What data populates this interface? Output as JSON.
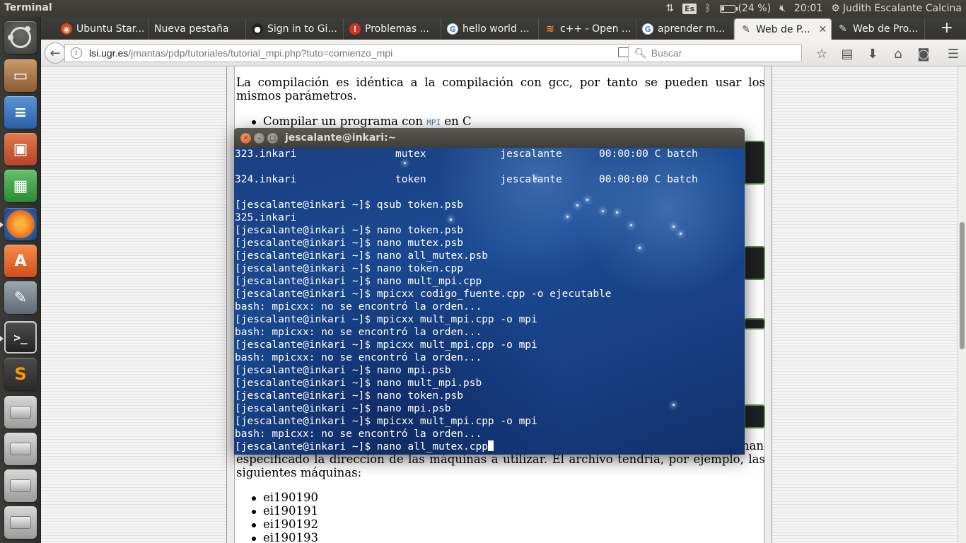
{
  "top_panel": {
    "app_title": "Terminal",
    "keyboard_layout": "Es",
    "battery_text": "(24 %)",
    "battery_level": 0.24,
    "time": "20:01",
    "user_name": "Judith Escalante Calcina"
  },
  "tabs": [
    {
      "label": "Ubuntu Star...",
      "icon": "ubuntu-icon",
      "color": "#dd4814"
    },
    {
      "label": "Nueva pestaña",
      "icon": "none",
      "color": ""
    },
    {
      "label": "Sign in to Gi...",
      "icon": "github-icon",
      "color": "#222222"
    },
    {
      "label": "Problemas ...",
      "icon": "alert-icon",
      "color": "#d93025"
    },
    {
      "label": "hello world ...",
      "icon": "google-icon",
      "color": "#4285f4"
    },
    {
      "label": "c++ - Open ...",
      "icon": "stackoverflow-icon",
      "color": "#f48024"
    },
    {
      "label": "aprender m...",
      "icon": "google-icon",
      "color": "#4285f4"
    },
    {
      "label": "Web de P...",
      "icon": "pen-icon",
      "color": "#444444",
      "active": true
    },
    {
      "label": "Web de Pro...",
      "icon": "pen-icon",
      "color": "#444444"
    }
  ],
  "navbar": {
    "url_host": "lsi.ugr.es",
    "url_path": "/jmantas/pdp/tutoriales/tutorial_mpi.php?tuto=comienzo_mpi",
    "search_placeholder": "Buscar"
  },
  "page": {
    "para1": "La compilación es idéntica a la compilación con gcc, por tanto se pueden usar los mismos parámetros.",
    "li1_prefix": "Compilar un programa con",
    "li1_code": "MPI",
    "li1_suffix": "en C",
    "para2_first_word": "han",
    "para2_rest": "especificado la dirección de las máquinas a utilizar. El archivo tendría, por ejemplo, las siguientes máquinas:",
    "machines": [
      "ei190190",
      "ei190191",
      "ei190192",
      "ei190193"
    ]
  },
  "terminal": {
    "title": "jescalante@inkari:~",
    "lines": [
      "323.inkari                mutex            jescalante      00:00:00 C batch",
      "",
      "324.inkari                token            jescalante      00:00:00 C batch",
      "",
      "[jescalante@inkari ~]$ qsub token.psb",
      "325.inkari",
      "[jescalante@inkari ~]$ nano token.psb",
      "[jescalante@inkari ~]$ nano mutex.psb",
      "[jescalante@inkari ~]$ nano all_mutex.psb",
      "[jescalante@inkari ~]$ nano token.cpp",
      "[jescalante@inkari ~]$ nano mult_mpi.cpp",
      "[jescalante@inkari ~]$ mpicxx codigo_fuente.cpp -o ejecutable",
      "bash: mpicxx: no se encontró la orden...",
      "[jescalante@inkari ~]$ mpicxx mult_mpi.cpp -o mpi",
      "bash: mpicxx: no se encontró la orden...",
      "[jescalante@inkari ~]$ mpicxx mult_mpi.cpp -o mpi",
      "bash: mpicxx: no se encontró la orden...",
      "[jescalante@inkari ~]$ nano mpi.psb",
      "[jescalante@inkari ~]$ nano mult_mpi.psb",
      "[jescalante@inkari ~]$ nano token.psb",
      "[jescalante@inkari ~]$ nano mpi.psb",
      "[jescalante@inkari ~]$ mpicxx mult_mpi.cpp -o mpi",
      "bash: mpicxx: no se encontró la orden...",
      "[jescalante@inkari ~]$ nano all_mutex.cpp"
    ]
  }
}
